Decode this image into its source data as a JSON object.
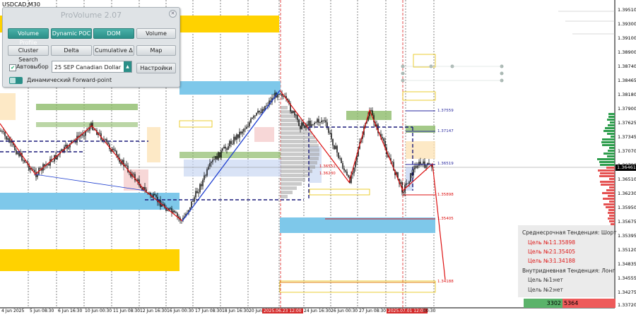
{
  "symbol": "USDCAD,M30",
  "panel": {
    "title": "ProVolume 2.07",
    "buttons": [
      {
        "label": "Volume Profile",
        "style": "teal"
      },
      {
        "label": "Dynamic POC",
        "style": "teal"
      },
      {
        "label": "DOM",
        "style": "teal"
      },
      {
        "label": "Volume",
        "style": "grey"
      },
      {
        "label": "Cluster Search",
        "style": "grey"
      },
      {
        "label": "Delta",
        "style": "grey"
      },
      {
        "label": "Cumulative Δ",
        "style": "grey"
      },
      {
        "label": "Map",
        "style": "grey"
      }
    ],
    "auto_select_label": "Автовыбор",
    "contract_value": "25 SEP Canadian Dollar",
    "settings_label": "Настройки",
    "forward_point_label": "Динамический Forward-point"
  },
  "price_axis": [
    "1.39510",
    "1.39300",
    "1.39100",
    "1.38900",
    "1.38740",
    "1.38465",
    "1.38180",
    "1.37900",
    "1.37625",
    "1.37345",
    "1.37070",
    "1.36790",
    "1.36510",
    "1.36230",
    "1.35950",
    "1.35675",
    "1.35395",
    "1.35120",
    "1.34835",
    "1.34555",
    "1.34275",
    "1.34000",
    "1.33720"
  ],
  "current_price": "1.36461",
  "date_axis": [
    "4 Jun 2025",
    "5 Jun 08:30",
    "6 Jun 16:30",
    "10 Jun 00:30",
    "11 Jun 08:30",
    "12 Jun 16:30",
    "16 Jun 00:30",
    "17 Jun 08:30",
    "18 Jun 16:30",
    "20 Jun",
    "2025.06.23 12:00",
    "24 Jun 16:30",
    "26 Jun 00:30",
    "27 Jun 08:30",
    "2025.07.01 12:00",
    "00:30"
  ],
  "highlighted_dates": [
    "2025.06.23 12:00",
    "2025.07.01 12:00"
  ],
  "level_labels": [
    {
      "text": "1.37559",
      "color": "#2a2aa0"
    },
    {
      "text": "1.37147",
      "color": "#2a2aa0"
    },
    {
      "text": "1.36519",
      "color": "#2a2aa0"
    },
    {
      "text": "1.35898",
      "color": "#d11"
    },
    {
      "text": "1.35405",
      "color": "#d11"
    },
    {
      "text": "1.34188",
      "color": "#d11"
    }
  ],
  "chart_tags": [
    "1.36230",
    "1.36551"
  ],
  "info": {
    "medium_title": "Среднесрочная Тенденция: Шорт",
    "medium_targets": [
      {
        "label": "Цель №1:",
        "value": "1.35898"
      },
      {
        "label": "Цель №2:",
        "value": "1.35405"
      },
      {
        "label": "Цель №3:",
        "value": "1.34188"
      }
    ],
    "intraday_title": "Внутридневная Тенденция: Лонг",
    "intraday_targets": [
      {
        "label": "Цель №1:",
        "value": "нет"
      },
      {
        "label": "Цель №2:",
        "value": "нет"
      }
    ]
  },
  "dom": {
    "bid": "3302",
    "ask": "5364"
  },
  "colors": {
    "accent_teal": "#2b8f88",
    "target_red": "#d11111",
    "level_blue": "#2a2aa0",
    "zone_gold": "#ffd200",
    "zone_skyblue": "#7ec8ea",
    "zone_green": "#8dbb6a"
  }
}
